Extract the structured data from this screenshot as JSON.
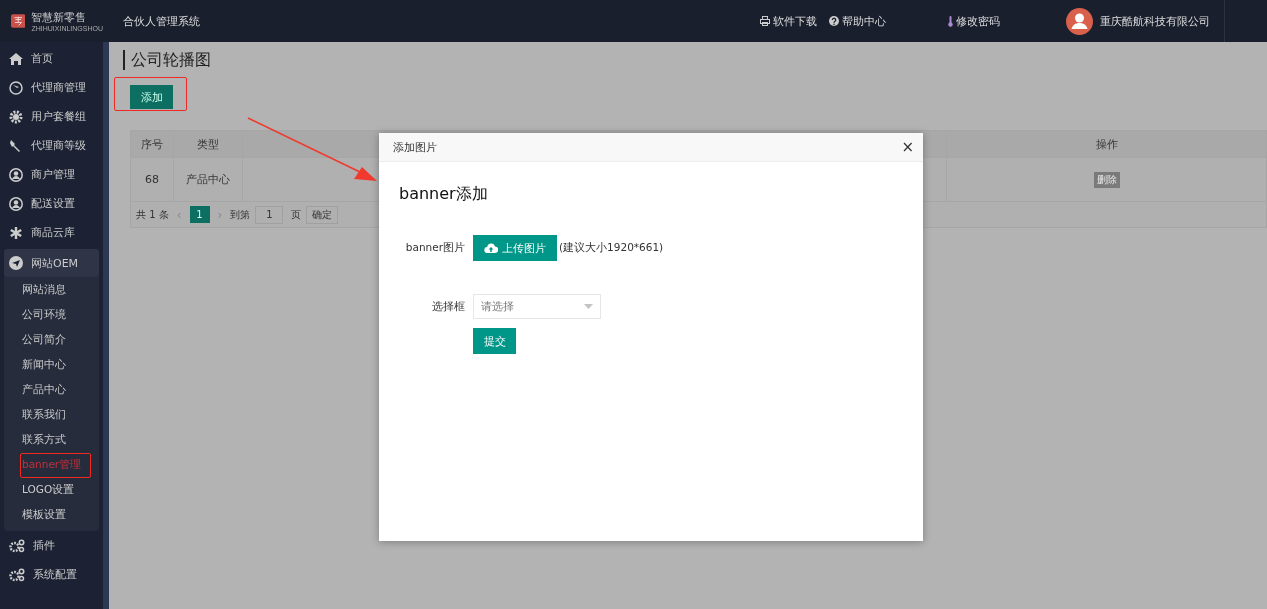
{
  "header": {
    "brand": "智慧新零售",
    "brand_sub": "ZHIHUIXINLINGSHOU",
    "system_title": "合伙人管理系统",
    "links": [
      "软件下载",
      "帮助中心",
      "修改密码"
    ],
    "company": "重庆酷航科技有限公司"
  },
  "sidebar": {
    "items": [
      {
        "label": "首页",
        "selected": false
      },
      {
        "label": "代理商管理",
        "selected": false
      },
      {
        "label": "用户套餐组",
        "selected": false
      },
      {
        "label": "代理商等级",
        "selected": false
      },
      {
        "label": "商户管理",
        "selected": false
      },
      {
        "label": "配送设置",
        "selected": false
      },
      {
        "label": "商品云库",
        "selected": false
      },
      {
        "label": "网站OEM",
        "selected": false,
        "expanded": true,
        "children": [
          {
            "label": "网站消息",
            "selected": false
          },
          {
            "label": "公司环境",
            "selected": false
          },
          {
            "label": "公司简介",
            "selected": false
          },
          {
            "label": "新闻中心",
            "selected": false
          },
          {
            "label": "产品中心",
            "selected": false
          },
          {
            "label": "联系我们",
            "selected": false
          },
          {
            "label": "联系方式",
            "selected": false
          },
          {
            "label": "banner管理",
            "selected": true
          },
          {
            "label": "LOGO设置",
            "selected": false
          },
          {
            "label": "模板设置",
            "selected": false
          }
        ]
      },
      {
        "label": "插件",
        "selected": false
      },
      {
        "label": "系统配置",
        "selected": false
      }
    ]
  },
  "page": {
    "title": "公司轮播图",
    "add_button": "添加"
  },
  "table": {
    "columns": [
      "序号",
      "类型",
      "",
      "操作"
    ],
    "rows": [
      {
        "id": "68",
        "type": "产品中心",
        "action": "删除"
      }
    ]
  },
  "pagination": {
    "total": "共 1 条",
    "prev": "‹",
    "pages": [
      {
        "label": "1",
        "selected": true
      }
    ],
    "next": "›",
    "goto_label": "到第",
    "goto_value": "1",
    "page_unit": "页",
    "confirm": "确定"
  },
  "dialog": {
    "title": "添加图片",
    "close": "×",
    "heading": "banner添加",
    "image_label": "banner图片",
    "upload_button": "上传图片",
    "upload_hint": "(建议大小1920*661)",
    "select_label": "选择框",
    "select_placeholder": "请选择",
    "submit": "提交"
  }
}
